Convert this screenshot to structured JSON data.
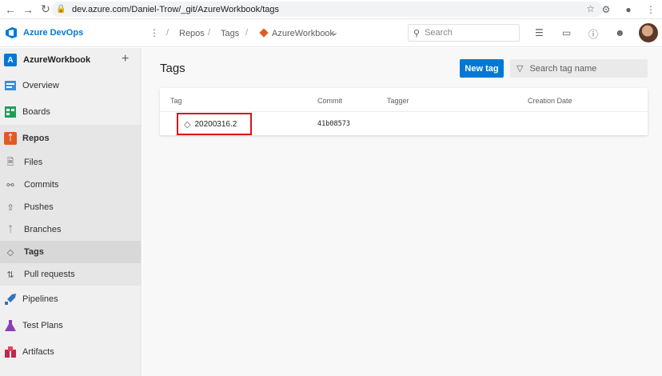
{
  "browser": {
    "url": "dev.azure.com/Daniel-Trow/_git/AzureWorkbook/tags",
    "back_icon": "arrow-left-icon",
    "forward_icon": "arrow-right-icon",
    "reload_icon": "reload-icon",
    "lock_icon": "lock-icon",
    "star_icon": "star-icon"
  },
  "header": {
    "product": "Azure DevOps",
    "breadcrumbs": [
      "Repos",
      "Tags",
      "AzureWorkbook"
    ],
    "search_placeholder": "Search",
    "accent": "#0078d4"
  },
  "sidebar": {
    "project_initial": "A",
    "project_name": "AzureWorkbook",
    "items": [
      {
        "label": "Overview",
        "icon": "overview-icon"
      },
      {
        "label": "Boards",
        "icon": "boards-icon"
      },
      {
        "label": "Repos",
        "icon": "repos-icon"
      },
      {
        "label": "Files",
        "icon": "files-icon"
      },
      {
        "label": "Commits",
        "icon": "commits-icon"
      },
      {
        "label": "Pushes",
        "icon": "pushes-icon"
      },
      {
        "label": "Branches",
        "icon": "branches-icon"
      },
      {
        "label": "Tags",
        "icon": "tag-icon",
        "selected": true
      },
      {
        "label": "Pull requests",
        "icon": "pull-request-icon"
      },
      {
        "label": "Pipelines",
        "icon": "pipelines-icon"
      },
      {
        "label": "Test Plans",
        "icon": "test-plans-icon"
      },
      {
        "label": "Artifacts",
        "icon": "artifacts-icon"
      }
    ]
  },
  "main": {
    "title": "Tags",
    "new_tag_label": "New tag",
    "filter_placeholder": "Search tag name",
    "columns": [
      "Tag",
      "Commit",
      "Tagger",
      "Creation Date"
    ],
    "rows": [
      {
        "tag": "20200316.2",
        "commit": "41b08573",
        "tagger": "",
        "creation_date": ""
      }
    ],
    "highlight_color": "#d9131b"
  }
}
